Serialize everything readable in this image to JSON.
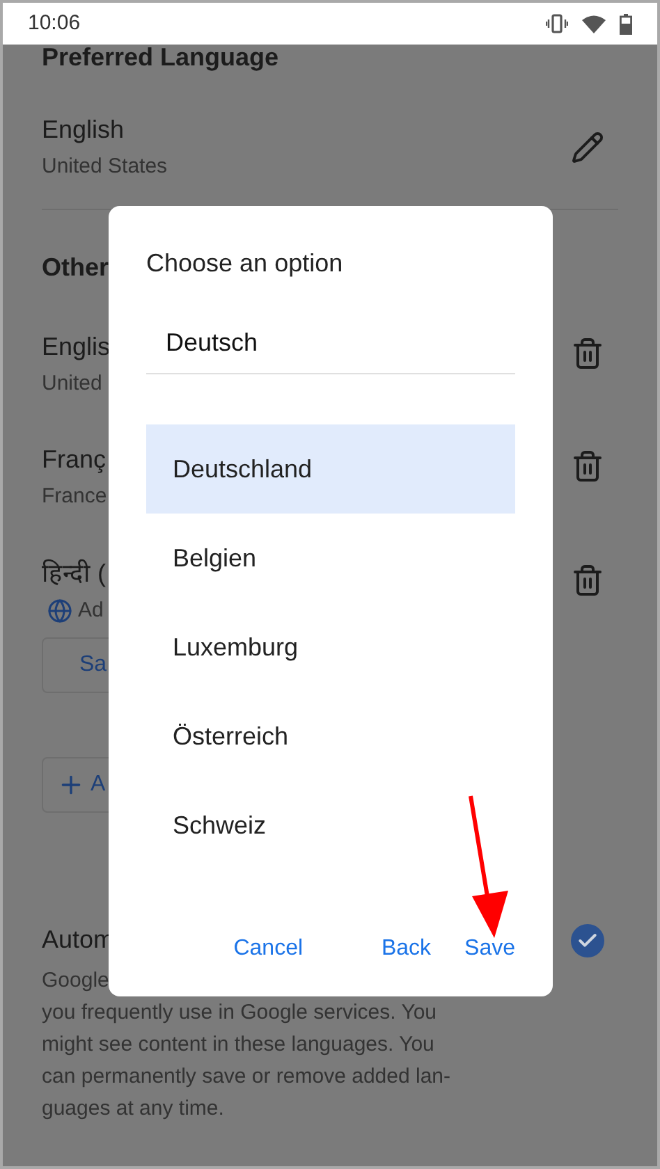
{
  "status_bar": {
    "time": "10:06"
  },
  "preferred": {
    "heading": "Preferred Language",
    "language": "English",
    "region": "United States"
  },
  "other": {
    "heading": "Other",
    "languages": [
      {
        "language": "Englis",
        "region": "United"
      },
      {
        "language": "Franç",
        "region": "France"
      },
      {
        "language": "हिन्दी (",
        "note": "Ad"
      }
    ],
    "save_button": "Sa",
    "add_button": "A"
  },
  "auto": {
    "title": "Autom",
    "checked": true,
    "lines": [
      "Google",
      "you frequently use in Google services. You",
      "might see content in these languages. You",
      "can permanently save or remove added lan-",
      "guages at any time."
    ]
  },
  "dialog": {
    "title": "Choose an option",
    "field_value": "Deutsch",
    "options": [
      {
        "label": "Deutschland",
        "selected": true
      },
      {
        "label": "Belgien",
        "selected": false
      },
      {
        "label": "Luxemburg",
        "selected": false
      },
      {
        "label": "Österreich",
        "selected": false
      },
      {
        "label": "Schweiz",
        "selected": false
      }
    ],
    "buttons": [
      "Cancel",
      "Back",
      "Save"
    ]
  }
}
